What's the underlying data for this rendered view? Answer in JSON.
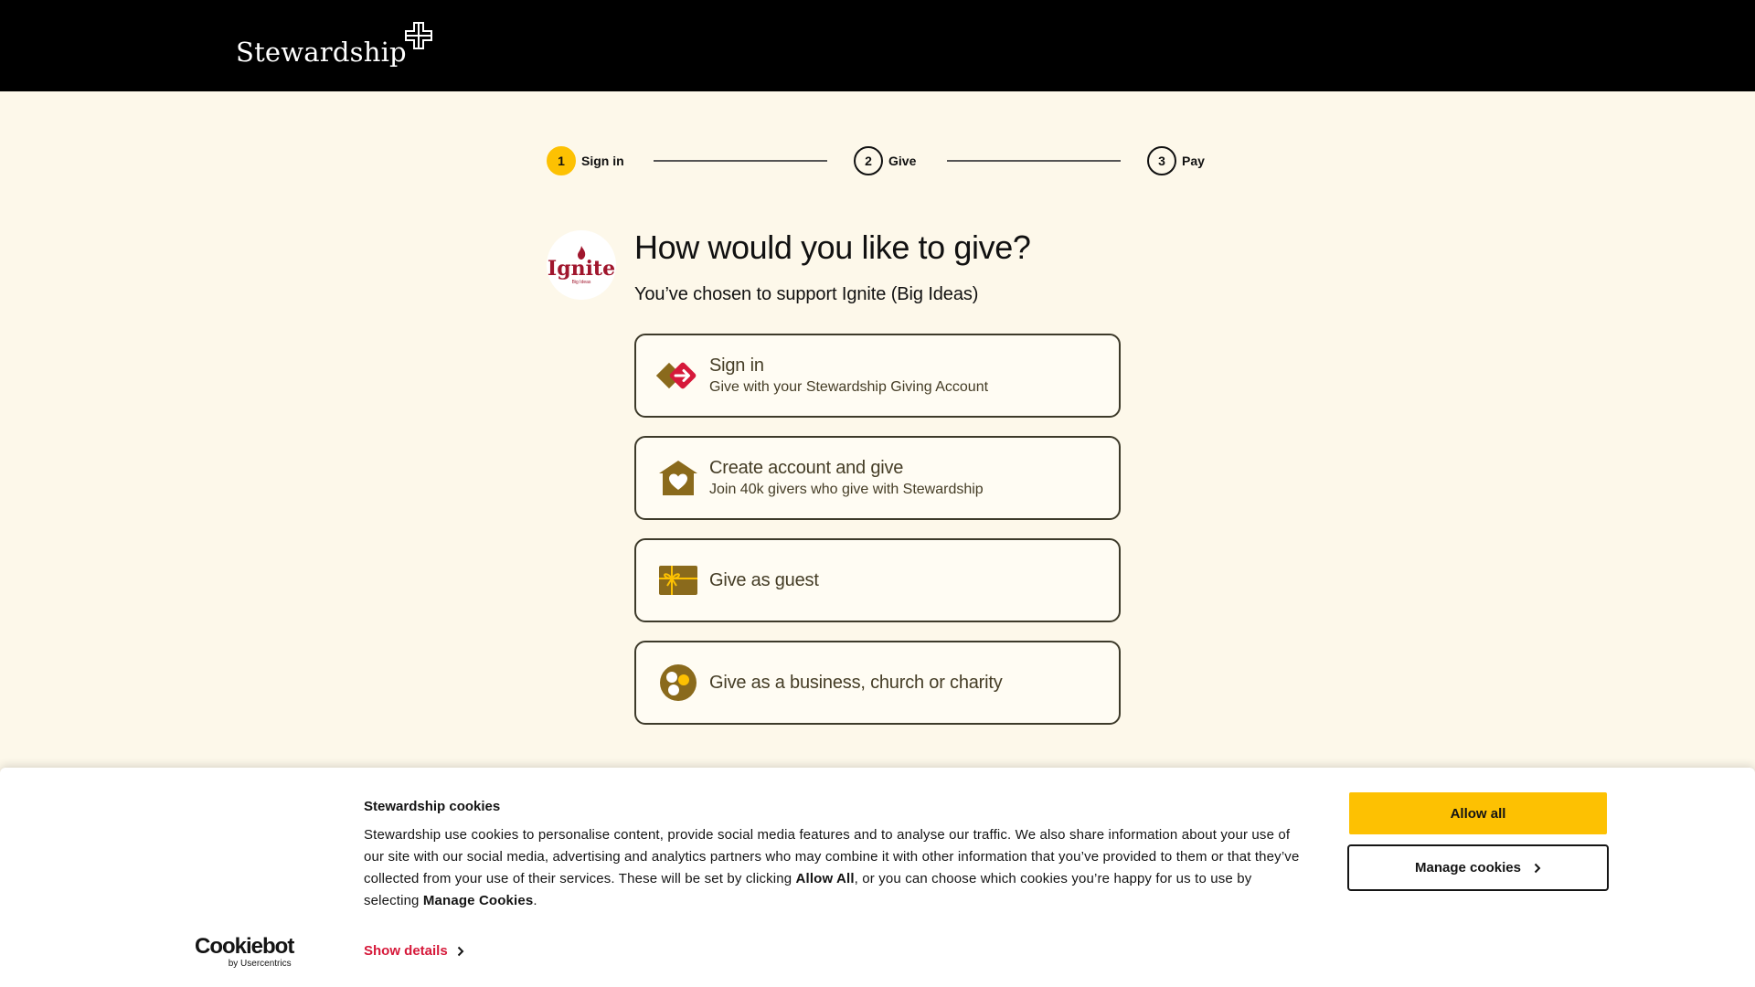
{
  "header": {
    "logo_text": "Stewardship"
  },
  "stepper": {
    "steps": [
      {
        "num": "1",
        "label": "Sign in",
        "active": true
      },
      {
        "num": "2",
        "label": "Give",
        "active": false
      },
      {
        "num": "3",
        "label": "Pay",
        "active": false
      }
    ]
  },
  "org": {
    "logo_name": "Ignite",
    "logo_sub": "Big Ideas"
  },
  "main": {
    "title": "How would you like to give?",
    "subtitle": "You’ve chosen to support Ignite (Big Ideas)",
    "options": [
      {
        "icon": "sign-in-arrow-icon",
        "title": "Sign in",
        "sub": "Give with your Stewardship Giving Account"
      },
      {
        "icon": "house-heart-icon",
        "title": "Create account and give",
        "sub": "Join 40k givers who give with Stewardship"
      },
      {
        "icon": "gift-icon",
        "title": "Give as guest",
        "sub": ""
      },
      {
        "icon": "organisation-icon",
        "title": "Give as a business, church or charity",
        "sub": ""
      }
    ]
  },
  "cookies": {
    "title": "Stewardship cookies",
    "body_1": "Stewardship use cookies to personalise content, provide social media features and to analyse our traffic. We also share information about your use of our site with our social media, advertising and analytics partners who may combine it with other information that you’ve provided to them or that they’ve collected from your use of their services. These will be set by clicking ",
    "body_bold_1": "Allow All",
    "body_2": ", or you can choose which cookies you’re happy for us to use by selecting ",
    "body_bold_2": "Manage Cookies",
    "body_3": ".",
    "allow_label": "Allow all",
    "manage_label": "Manage cookies",
    "show_details_label": "Show details",
    "brand_name": "Cookiebot",
    "brand_by": "by Usercentrics"
  },
  "colors": {
    "accent": "#fdc102",
    "background": "#fdf8ea",
    "icon_brown": "#8a6a1c",
    "icon_red": "#d6193a",
    "link_red": "#d6193a"
  }
}
